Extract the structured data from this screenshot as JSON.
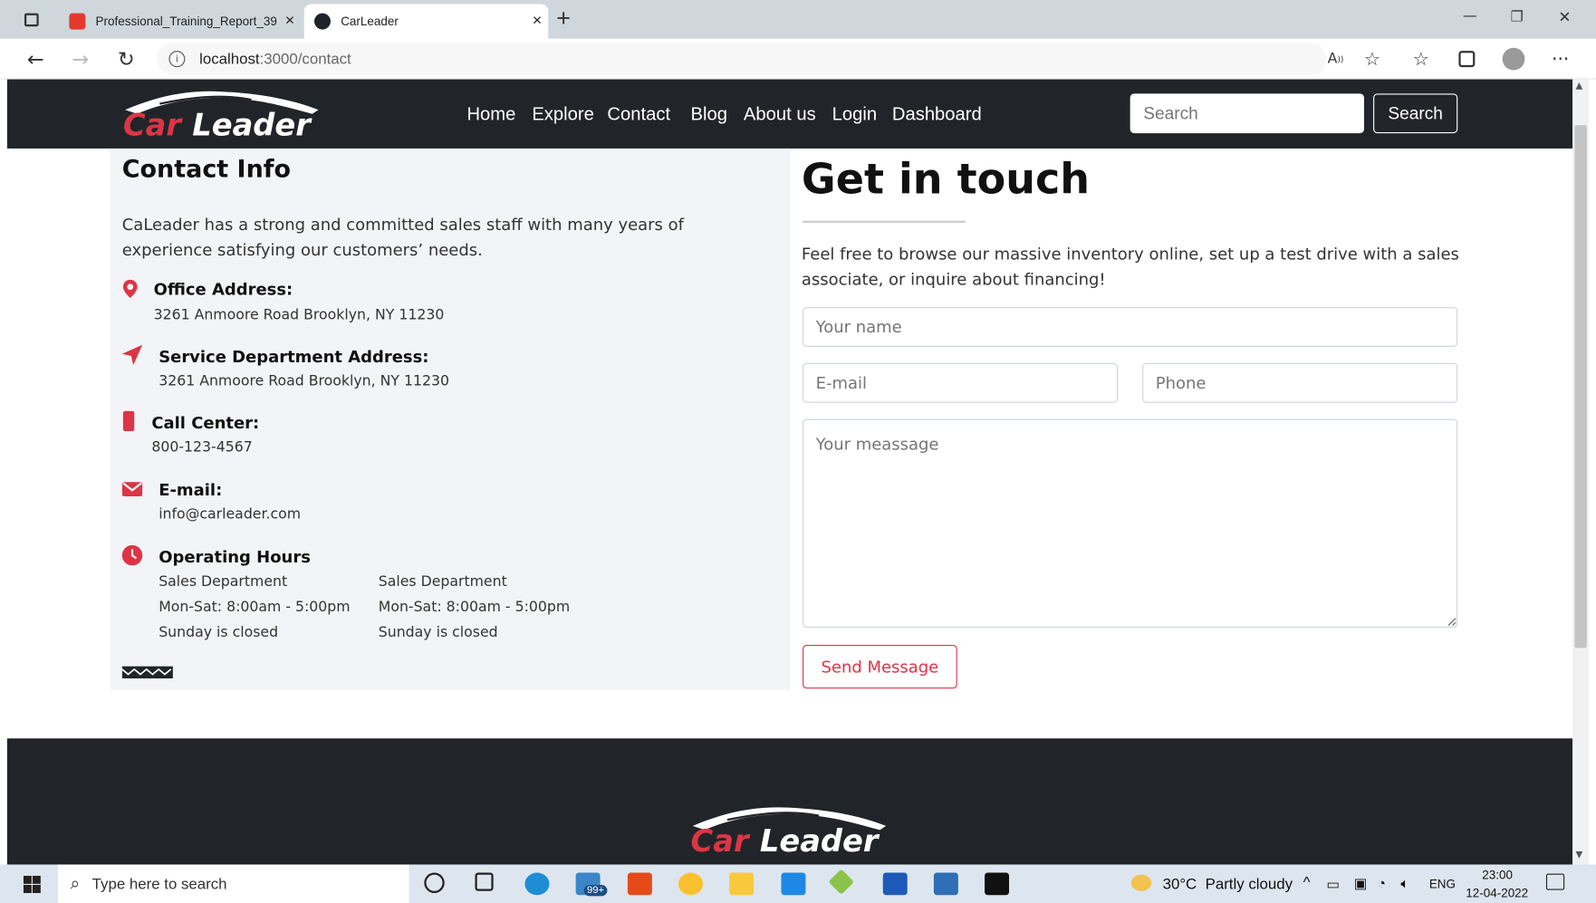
{
  "browser": {
    "tabs": [
      {
        "title": "Professional_Training_Report_39",
        "close": "×"
      },
      {
        "title": "CarLeader",
        "close": "×"
      }
    ],
    "new_tab": "+",
    "url_host": "localhost",
    "url_path": ":3000/contact",
    "window_controls": {
      "minimize": "—",
      "restore": "❐",
      "close": "✕"
    }
  },
  "site": {
    "logo_text": {
      "part1": "Car",
      "part2": "Leader"
    },
    "nav": [
      "Home",
      "Explore",
      "Contact",
      "Blog",
      "About us",
      "Login",
      "Dashboard"
    ],
    "search": {
      "placeholder": "Search",
      "button": "Search"
    }
  },
  "contact_info": {
    "heading": "Contact Info",
    "intro": "CaLeader has a strong and committed sales staff with many years of experience satisfying our customers’ needs.",
    "items": [
      {
        "icon": "map-pin-icon",
        "title": "Office Address:",
        "text": "3261 Anmoore Road Brooklyn, NY 11230"
      },
      {
        "icon": "location-arrow-icon",
        "title": "Service Department Address:",
        "text": "3261 Anmoore Road Brooklyn, NY 11230"
      },
      {
        "icon": "mobile-phone-icon",
        "title": "Call Center:",
        "text": "800-123-4567"
      },
      {
        "icon": "envelope-icon",
        "title": "E-mail:",
        "text": "info@carleader.com"
      },
      {
        "icon": "clock-icon",
        "title": "Operating Hours",
        "text": ""
      }
    ],
    "hours": [
      {
        "dept": "Sales Department",
        "days": "Mon-Sat: 8:00am - 5:00pm",
        "closed": "Sunday is closed"
      },
      {
        "dept": "Sales Department",
        "days": "Mon-Sat: 8:00am - 5:00pm",
        "closed": "Sunday is closed"
      }
    ]
  },
  "form": {
    "heading": "Get in touch",
    "text": "Feel free to browse our massive inventory online, set up a test drive with a sales associate, or inquire about financing!",
    "name_placeholder": "Your name",
    "email_placeholder": "E-mail",
    "phone_placeholder": "Phone",
    "message_placeholder": "Your meassage",
    "send": "Send Message"
  },
  "taskbar": {
    "search_placeholder": "Type here to search",
    "mail_badge": "99+",
    "weather": "30°C  Partly cloudy",
    "lang": "ENG",
    "time": "23:00",
    "date": "12-04-2022"
  },
  "colors": {
    "accent": "#dc3545",
    "navbar": "#212529"
  }
}
